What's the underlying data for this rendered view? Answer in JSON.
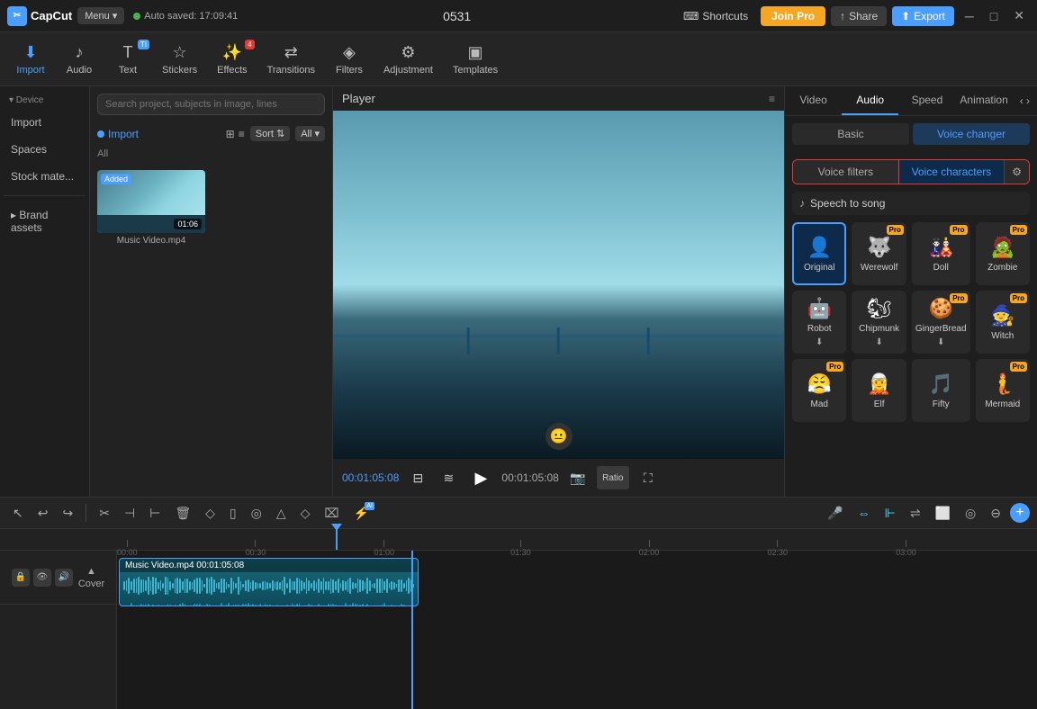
{
  "app": {
    "logo_text": "CapCut",
    "menu_label": "Menu",
    "auto_saved": "Auto saved: 17:09:41",
    "title": "0531",
    "shortcuts_label": "Shortcuts",
    "join_pro_label": "Join Pro",
    "share_label": "Share",
    "export_label": "Export"
  },
  "toolbar": {
    "items": [
      {
        "id": "import",
        "label": "Import",
        "icon": "⬇"
      },
      {
        "id": "audio",
        "label": "Audio",
        "icon": "♪"
      },
      {
        "id": "text",
        "label": "Text",
        "icon": "T"
      },
      {
        "id": "stickers",
        "label": "Stickers",
        "icon": "☆"
      },
      {
        "id": "effects",
        "label": "Effects",
        "icon": "✨"
      },
      {
        "id": "transitions",
        "label": "Transitions",
        "icon": "⇄"
      },
      {
        "id": "filters",
        "label": "Filters",
        "icon": "◈"
      },
      {
        "id": "adjustment",
        "label": "Adjustment",
        "icon": "⚙"
      },
      {
        "id": "templates",
        "label": "Templates",
        "icon": "▣"
      }
    ],
    "ti_text_label": "TI Text",
    "effects_count_label": "4 Effects"
  },
  "sidebar": {
    "items": [
      {
        "id": "device",
        "label": "Device",
        "has_dot": true
      },
      {
        "id": "import",
        "label": "Import"
      },
      {
        "id": "spaces",
        "label": "Spaces"
      },
      {
        "id": "stock_mate",
        "label": "Stock mate..."
      },
      {
        "id": "brand_assets",
        "label": "Brand assets"
      }
    ]
  },
  "media_panel": {
    "search_placeholder": "Search project, subjects in image, lines",
    "import_label": "Import",
    "sort_label": "Sort",
    "all_label": "All",
    "section_label": "All",
    "files": [
      {
        "name": "Music Video.mp4",
        "duration": "01:06",
        "added": true
      }
    ]
  },
  "player": {
    "title": "Player",
    "time_current": "00:01:05:08",
    "time_total": "00:01:05:08",
    "ratio_label": "Ratio"
  },
  "right_panel": {
    "tabs": [
      {
        "id": "video",
        "label": "Video"
      },
      {
        "id": "audio",
        "label": "Audio",
        "active": true
      },
      {
        "id": "speed",
        "label": "Speed"
      },
      {
        "id": "animation",
        "label": "Animation"
      }
    ],
    "basic_label": "Basic",
    "voice_changer_label": "Voice changer",
    "voice_filters_label": "Voice filters",
    "voice_characters_label": "Voice characters",
    "speech_to_song_label": "Speech to song",
    "voice_cards": [
      {
        "id": "original",
        "name": "Original",
        "icon": "👤",
        "pro": false,
        "selected": true
      },
      {
        "id": "werewolf",
        "name": "Werewolf",
        "icon": "🐺",
        "pro": true,
        "selected": false
      },
      {
        "id": "doll",
        "name": "Doll",
        "icon": "🎎",
        "pro": true,
        "selected": false
      },
      {
        "id": "zombie",
        "name": "Zombie",
        "icon": "🧟",
        "pro": true,
        "selected": false
      },
      {
        "id": "robot",
        "name": "Robot",
        "icon": "🤖",
        "pro": false,
        "selected": false
      },
      {
        "id": "chipmunk",
        "name": "Chipmunk",
        "icon": "🐿",
        "pro": false,
        "download": true,
        "selected": false
      },
      {
        "id": "gingerbread",
        "name": "GingerBread",
        "icon": "🍪",
        "pro": true,
        "download": true,
        "selected": false
      },
      {
        "id": "witch",
        "name": "Witch",
        "icon": "🧙",
        "pro": true,
        "selected": false
      },
      {
        "id": "mad",
        "name": "Mad",
        "icon": "😤",
        "pro": true,
        "selected": false
      },
      {
        "id": "elf",
        "name": "Elf",
        "icon": "🧝",
        "pro": false,
        "selected": false
      },
      {
        "id": "fifty",
        "name": "Fifty",
        "icon": "🔢",
        "pro": false,
        "selected": false
      },
      {
        "id": "mermaid",
        "name": "Mermaid",
        "icon": "🧜",
        "pro": true,
        "selected": false
      }
    ]
  },
  "timeline": {
    "ruler_marks": [
      "00:00",
      "00:30",
      "01:00",
      "01:30",
      "02:00",
      "02:30",
      "03:00"
    ],
    "track": {
      "clip_name": "Music Video.mp4",
      "clip_duration": "00:01:05:08",
      "cover_label": "Cover"
    }
  },
  "bottom_toolbar": {
    "undo_label": "Undo",
    "redo_label": "Redo"
  }
}
